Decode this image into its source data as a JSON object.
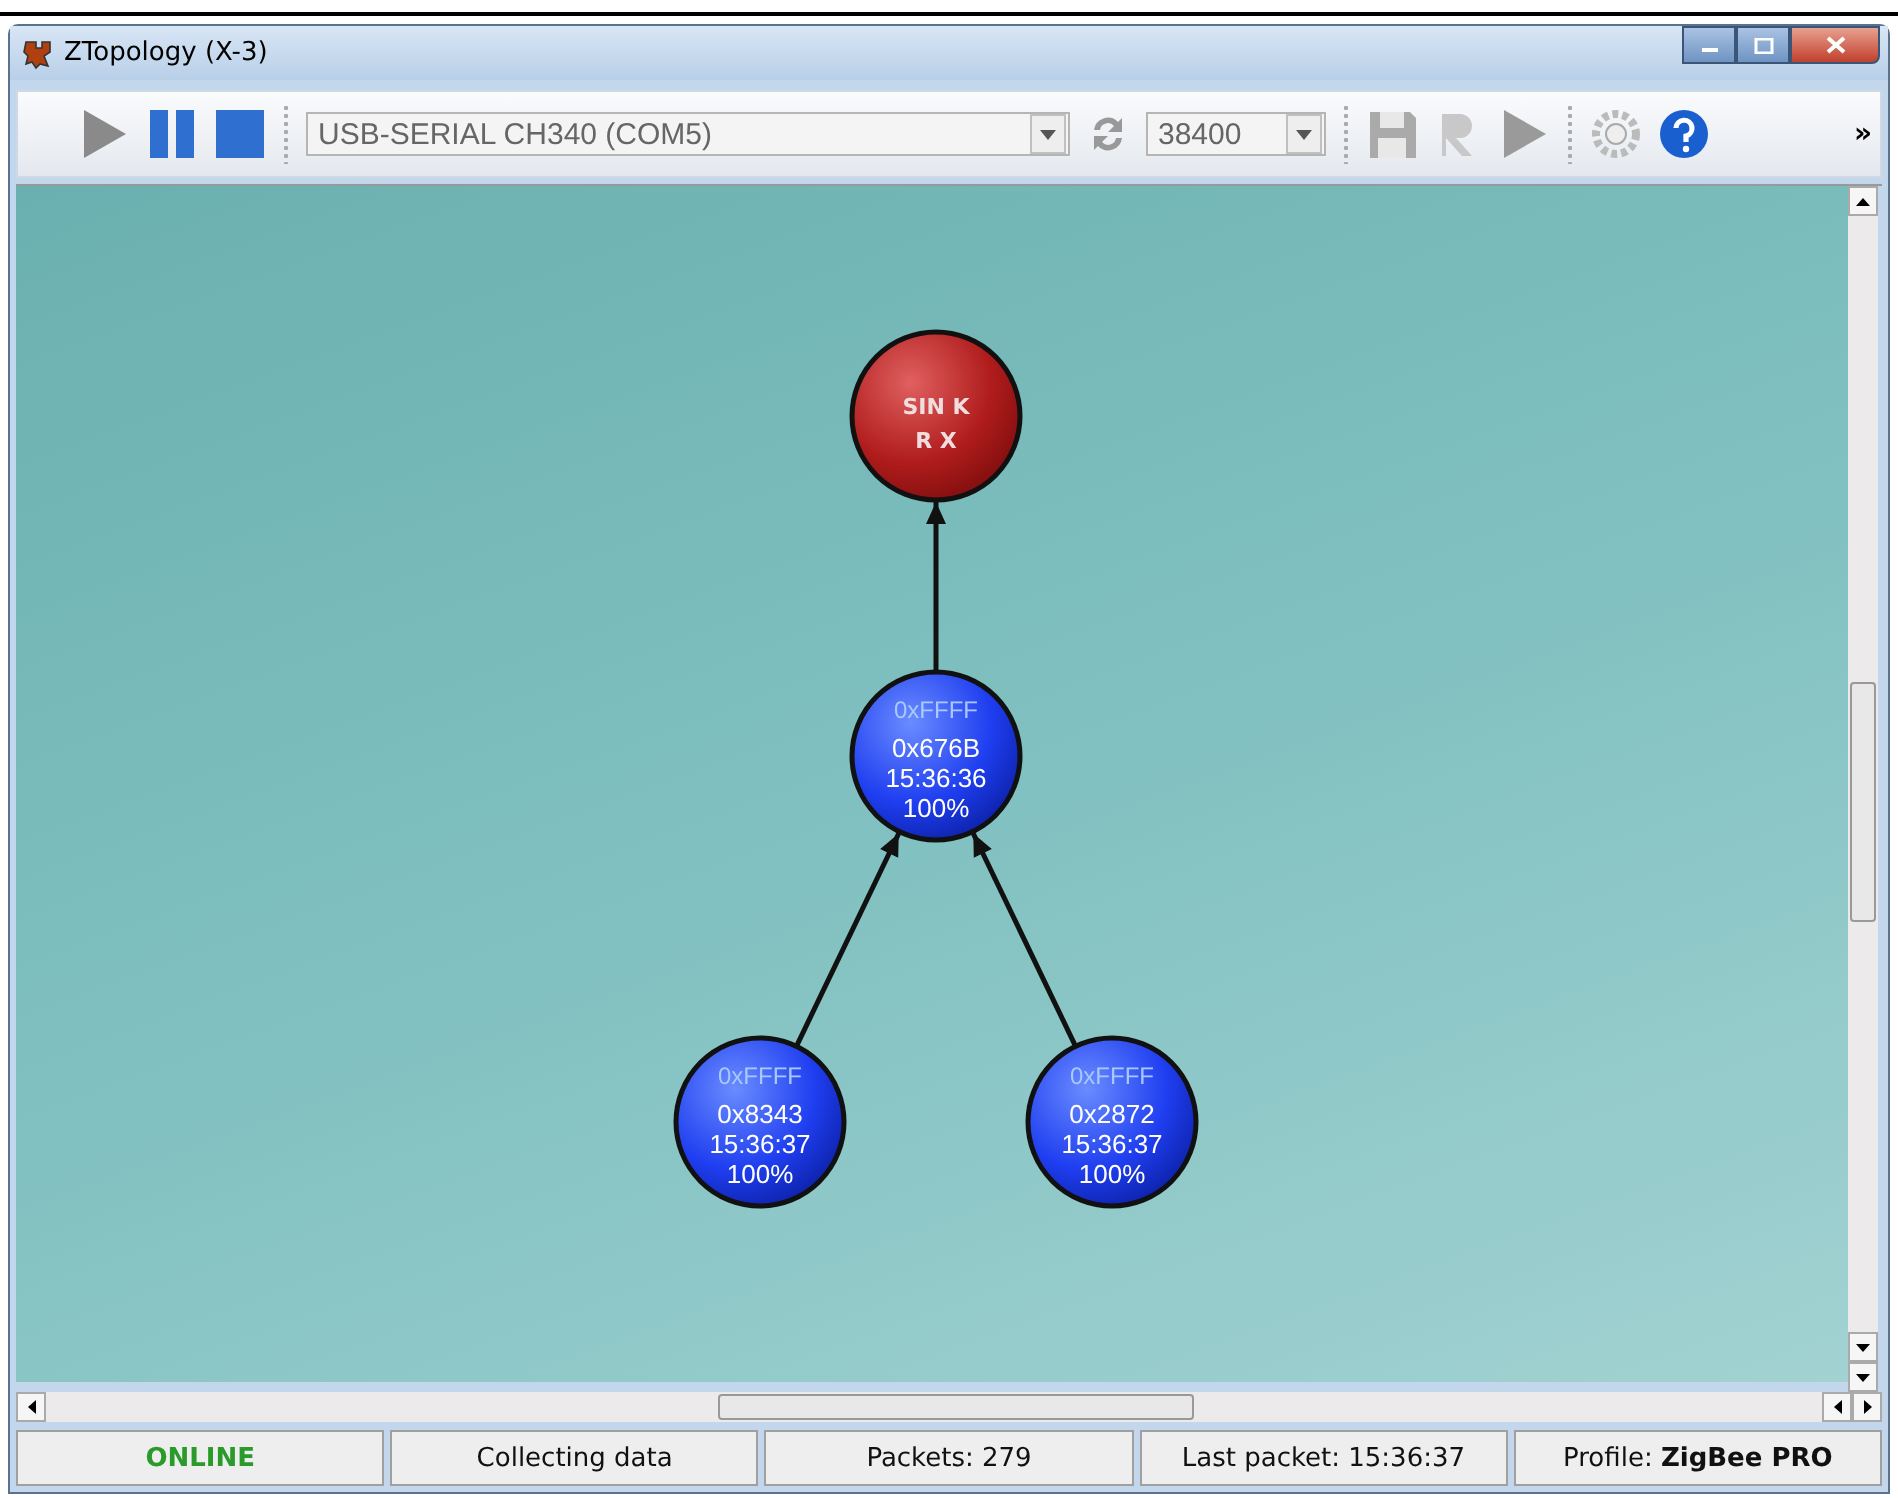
{
  "window": {
    "title": "ZTopology (X-3)"
  },
  "toolbar": {
    "port": {
      "value": "USB-SERIAL CH340 (COM5)"
    },
    "baud": {
      "value": "38400"
    },
    "overflow": "»"
  },
  "topology": {
    "kind": "sink",
    "lines": [
      "SIN K",
      "R X"
    ],
    "children": [
      {
        "kind": "router",
        "lines": [
          "0xFFFF",
          "0x676B",
          "15:36:36",
          "100%"
        ],
        "children": [
          {
            "kind": "router",
            "lines": [
              "0xFFFF",
              "0x8343",
              "15:36:37",
              "100%"
            ]
          },
          {
            "kind": "router",
            "lines": [
              "0xFFFF",
              "0x2872",
              "15:36:37",
              "100%"
            ]
          }
        ]
      }
    ]
  },
  "status_bar": [
    {
      "kind": "state",
      "text": "ONLINE"
    },
    {
      "kind": "text",
      "text": "Collecting data"
    },
    {
      "kind": "text",
      "text": "Packets: 279"
    },
    {
      "kind": "text",
      "text": "Last packet: 15:36:37"
    },
    {
      "kind": "text",
      "text": "Profile: **ZigBee PRO**"
    }
  ]
}
